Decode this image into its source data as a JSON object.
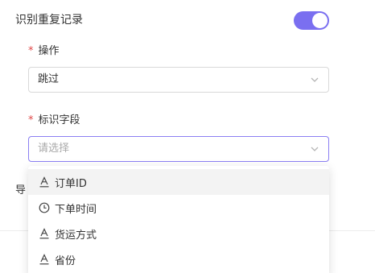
{
  "dedupe": {
    "label": "识别重复记录",
    "enabled": true
  },
  "operation": {
    "label": "操作",
    "required_mark": "*",
    "value": "跳过"
  },
  "id_field": {
    "label": "标识字段",
    "required_mark": "*",
    "placeholder": "请选择"
  },
  "partial_label": "导",
  "dropdown": {
    "options": [
      {
        "label": "订单ID",
        "icon": "text-field-icon"
      },
      {
        "label": "下单时间",
        "icon": "clock-icon"
      },
      {
        "label": "货运方式",
        "icon": "text-field-icon"
      },
      {
        "label": "省份",
        "icon": "text-field-icon"
      }
    ]
  },
  "colors": {
    "accent": "#7a6ff0",
    "required": "#e04848"
  }
}
